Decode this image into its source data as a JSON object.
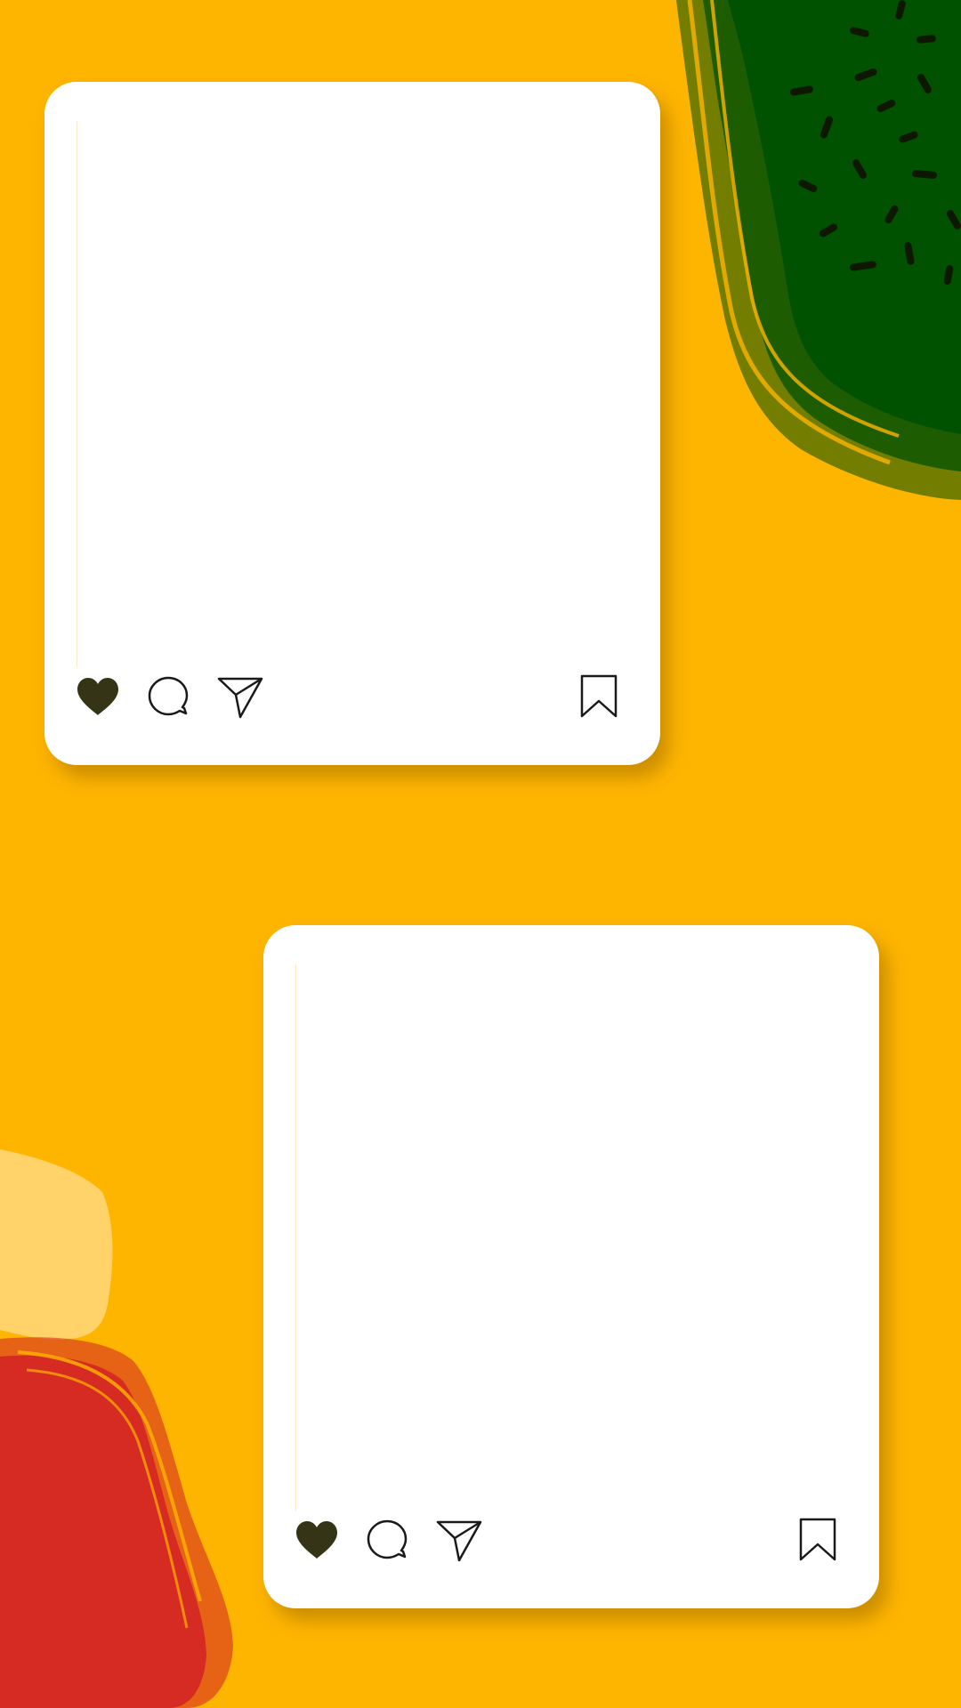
{
  "background_color": "#FEB500",
  "decorations": {
    "top_right_blob": {
      "color": "#005100",
      "speckle_color": "#0E1800"
    },
    "bottom_left_blob": {
      "color": "#D52B23"
    },
    "bottom_left_light_blob": {
      "color": "#FFD369"
    }
  },
  "posts": [
    {
      "icons": [
        "heart-icon",
        "comment-icon",
        "share-send-icon",
        "bookmark-icon"
      ],
      "liked": true,
      "heart_color": "#353417"
    },
    {
      "icons": [
        "heart-icon",
        "comment-icon",
        "share-send-icon",
        "bookmark-icon"
      ],
      "liked": true,
      "heart_color": "#353417"
    }
  ]
}
